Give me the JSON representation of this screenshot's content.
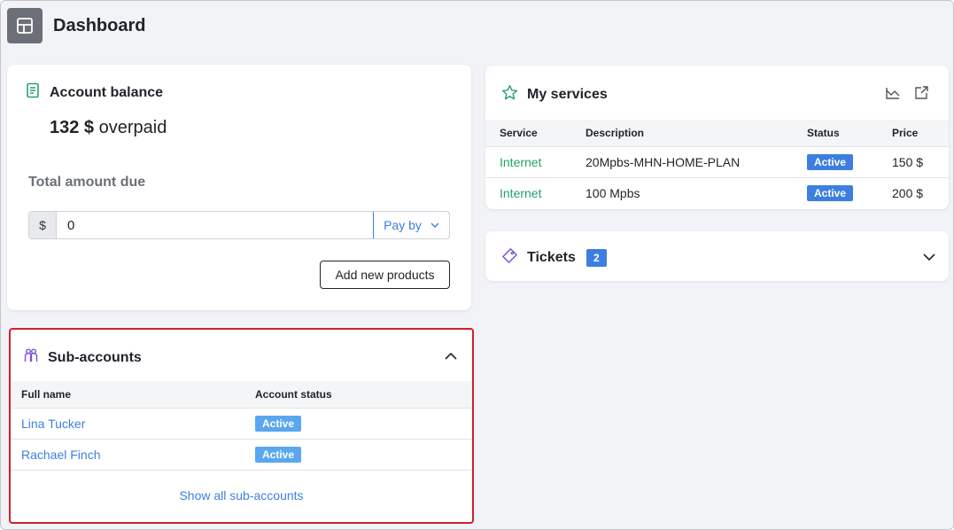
{
  "header": {
    "title": "Dashboard",
    "icon": "layout-icon"
  },
  "balance": {
    "title": "Account balance",
    "amount": "132 $",
    "amount_suffix": "overpaid",
    "due_label": "Total amount due",
    "currency_prefix": "$",
    "due_value": "0",
    "pay_by_label": "Pay by",
    "add_products_label": "Add new products"
  },
  "sub_accounts": {
    "title": "Sub-accounts",
    "columns": [
      "Full name",
      "Account status"
    ],
    "rows": [
      {
        "name": "Lina Tucker",
        "status": "Active"
      },
      {
        "name": "Rachael Finch",
        "status": "Active"
      }
    ],
    "show_all_label": "Show all sub-accounts"
  },
  "services": {
    "title": "My services",
    "columns": [
      "Service",
      "Description",
      "Status",
      "Price"
    ],
    "rows": [
      {
        "service": "Internet",
        "description": "20Mpbs-MHN-HOME-PLAN",
        "status": "Active",
        "price": "150 $"
      },
      {
        "service": "Internet",
        "description": "100 Mpbs",
        "status": "Active",
        "price": "200 $"
      }
    ]
  },
  "tickets": {
    "title": "Tickets",
    "count": "2"
  },
  "colors": {
    "accent_blue": "#3d7fe0",
    "service_green": "#27a06b",
    "highlight_red": "#d01f2c",
    "icon_purple": "#7b4fd6"
  }
}
